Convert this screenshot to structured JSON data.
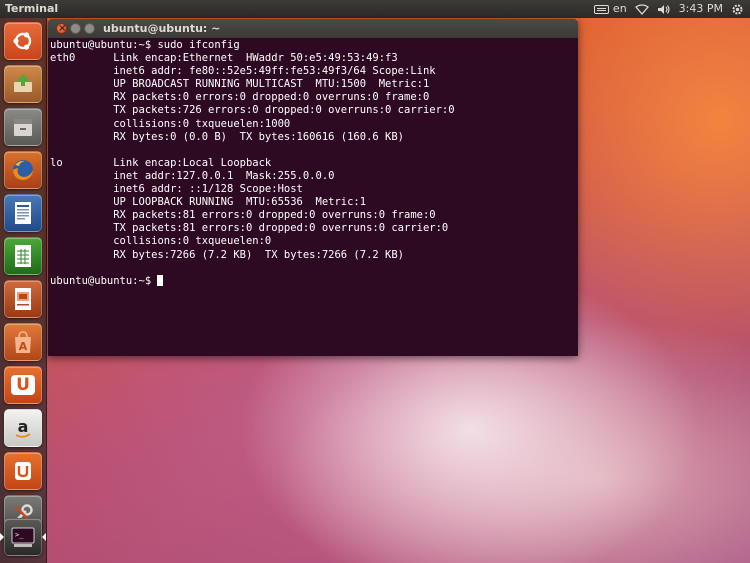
{
  "top_panel": {
    "app_title": "Terminal",
    "keyboard_layout": "en",
    "clock": "3:43 PM"
  },
  "launcher": {
    "items": [
      {
        "name": "dash-home",
        "icon": "ubuntu-logo-icon",
        "color": "#e05420"
      },
      {
        "name": "software-updater",
        "icon": "update-icon",
        "color": "#b86a2a"
      },
      {
        "name": "files",
        "icon": "file-cabinet-icon",
        "color": "#6b6b69"
      },
      {
        "name": "firefox",
        "icon": "firefox-icon",
        "color": "#d9541c"
      },
      {
        "name": "libreoffice-writer",
        "icon": "writer-icon",
        "color": "#2c5a9a"
      },
      {
        "name": "libreoffice-calc",
        "icon": "calc-icon",
        "color": "#2f8a2a"
      },
      {
        "name": "libreoffice-impress",
        "icon": "impress-icon",
        "color": "#b44a1c"
      },
      {
        "name": "ubuntu-software-center",
        "icon": "shopping-bag-icon",
        "color": "#d9541c"
      },
      {
        "name": "ubuntu-one",
        "icon": "ubuntu-one-icon",
        "color": "#e05420"
      },
      {
        "name": "amazon",
        "icon": "amazon-icon",
        "color": "#dcdcdc"
      },
      {
        "name": "ubuntu-one-music",
        "icon": "ubuntu-one-music-icon",
        "color": "#d9541c"
      },
      {
        "name": "system-settings",
        "icon": "wrench-icon",
        "color": "#5a5a58"
      },
      {
        "name": "terminal",
        "icon": "terminal-icon",
        "color": "#3c3c3a"
      }
    ]
  },
  "terminal": {
    "title": "ubuntu@ubuntu: ~",
    "background": "#2d0922",
    "lines": [
      "ubuntu@ubuntu:~$ sudo ifconfig",
      "eth0      Link encap:Ethernet  HWaddr 50:e5:49:53:49:f3",
      "          inet6 addr: fe80::52e5:49ff:fe53:49f3/64 Scope:Link",
      "          UP BROADCAST RUNNING MULTICAST  MTU:1500  Metric:1",
      "          RX packets:0 errors:0 dropped:0 overruns:0 frame:0",
      "          TX packets:726 errors:0 dropped:0 overruns:0 carrier:0",
      "          collisions:0 txqueuelen:1000",
      "          RX bytes:0 (0.0 B)  TX bytes:160616 (160.6 KB)",
      "",
      "lo        Link encap:Local Loopback",
      "          inet addr:127.0.0.1  Mask:255.0.0.0",
      "          inet6 addr: ::1/128 Scope:Host",
      "          UP LOOPBACK RUNNING  MTU:65536  Metric:1",
      "          RX packets:81 errors:0 dropped:0 overruns:0 frame:0",
      "          TX packets:81 errors:0 dropped:0 overruns:0 carrier:0",
      "          collisions:0 txqueuelen:0",
      "          RX bytes:7266 (7.2 KB)  TX bytes:7266 (7.2 KB)",
      ""
    ],
    "prompt": "ubuntu@ubuntu:~$ "
  }
}
